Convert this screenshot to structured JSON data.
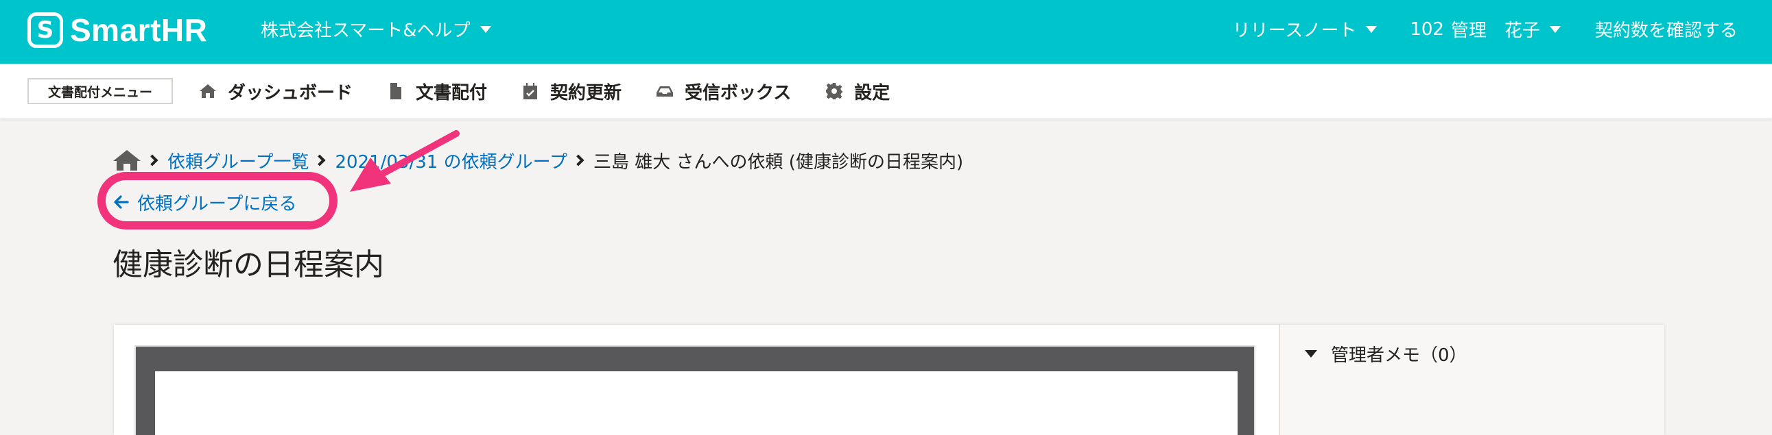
{
  "header": {
    "logo_mark": "S",
    "logo_text": "SmartHR",
    "tenant": "株式会社スマート&ヘルプ",
    "release_notes": "リリースノート",
    "user_id": "102",
    "user_name": "管理　花子",
    "contract_link": "契約数を確認する",
    "bg_color": "#00c4cc"
  },
  "appnav": {
    "menu_badge": "文書配付メニュー",
    "items": [
      {
        "label": "ダッシュボード",
        "icon": "home-icon"
      },
      {
        "label": "文書配付",
        "icon": "document-icon"
      },
      {
        "label": "契約更新",
        "icon": "calendar-check-icon"
      },
      {
        "label": "受信ボックス",
        "icon": "inbox-icon"
      },
      {
        "label": "設定",
        "icon": "gear-icon"
      }
    ]
  },
  "breadcrumb": {
    "home_icon": "home-icon",
    "items": [
      {
        "label": "依頼グループ一覧",
        "link": true
      },
      {
        "label": "2021/03/31 の依頼グループ",
        "link": true
      },
      {
        "label": "三島 雄大 さんへの依頼 (健康診断の日程案内)",
        "link": false
      }
    ]
  },
  "back_link": "依頼グループに戻る",
  "page_title": "健康診断の日程案内",
  "memo": {
    "label": "管理者メモ（0）"
  },
  "annotation_color": "#f0337a",
  "link_color": "#0071c1"
}
